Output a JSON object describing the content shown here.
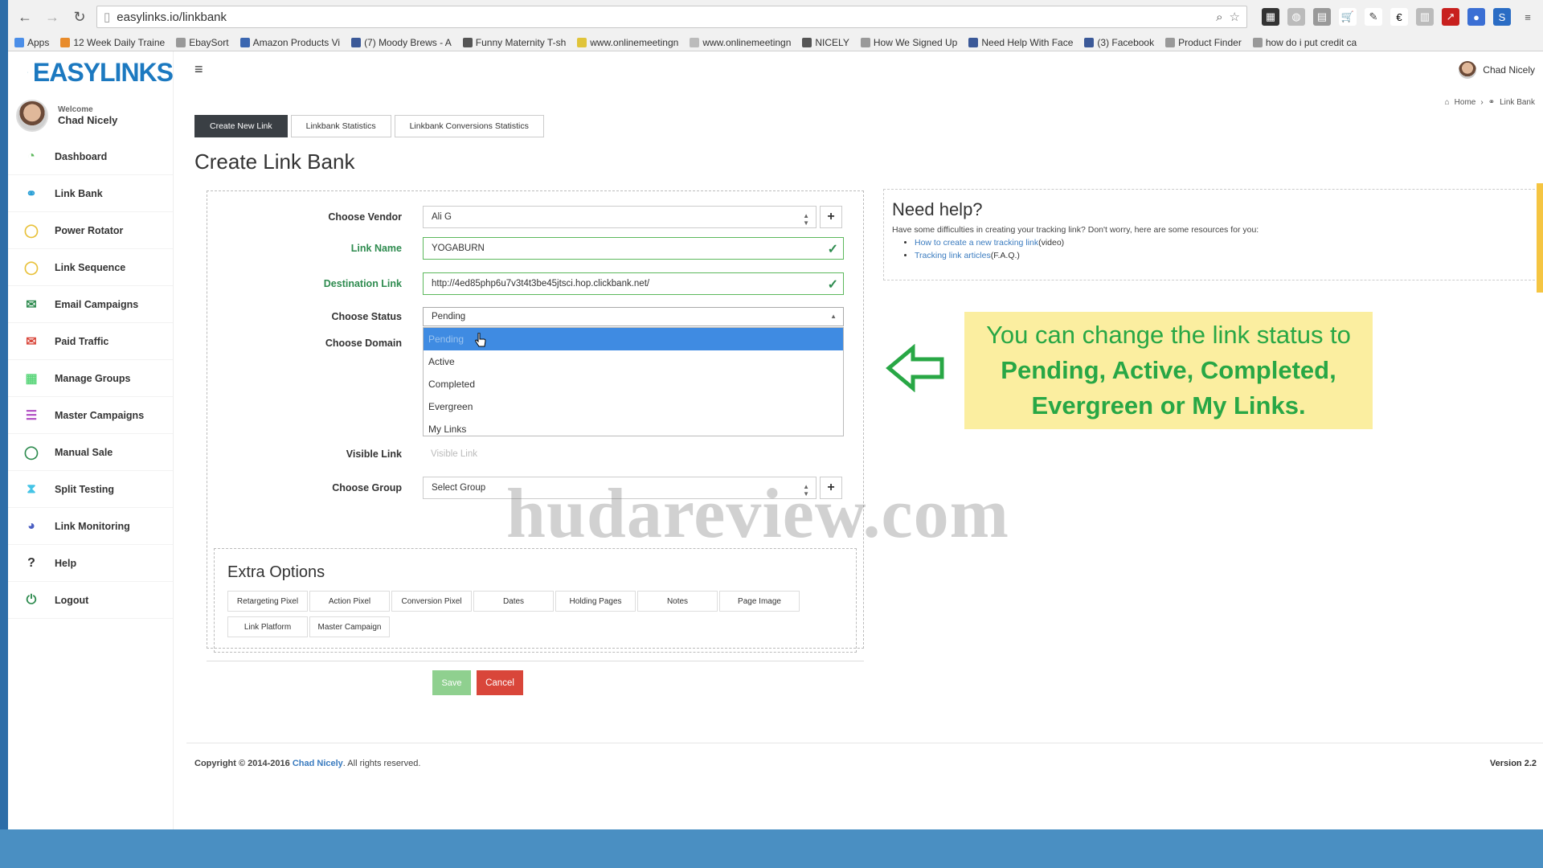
{
  "browser": {
    "url": "easylinks.io/linkbank",
    "bookmarks": [
      {
        "label": "Apps"
      },
      {
        "label": "12 Week Daily Traine"
      },
      {
        "label": "EbaySort"
      },
      {
        "label": "Amazon Products Vi"
      },
      {
        "label": "(7) Moody Brews - A"
      },
      {
        "label": "Funny Maternity T-sh"
      },
      {
        "label": "www.onlinemeetingn"
      },
      {
        "label": "www.onlinemeetingn"
      },
      {
        "label": "NICELY"
      },
      {
        "label": "How We Signed Up"
      },
      {
        "label": "Need Help With Face"
      },
      {
        "label": "(3) Facebook"
      },
      {
        "label": "Product Finder"
      },
      {
        "label": "how do i put credit ca"
      }
    ]
  },
  "brand": {
    "logo_text": "EASYLINKS"
  },
  "user": {
    "welcome": "Welcome",
    "name": "Chad Nicely",
    "top_name": "Chad Nicely"
  },
  "sidebar": {
    "items": [
      {
        "label": "Dashboard",
        "icon": "dashboard-icon",
        "color": "#5cb85c"
      },
      {
        "label": "Link Bank",
        "icon": "link-icon",
        "color": "#2a9fd6"
      },
      {
        "label": "Power Rotator",
        "icon": "rotator-icon",
        "color": "#e8c13a"
      },
      {
        "label": "Link Sequence",
        "icon": "sequence-icon",
        "color": "#e8c13a"
      },
      {
        "label": "Email Campaigns",
        "icon": "email-icon",
        "color": "#2e8b4f"
      },
      {
        "label": "Paid Traffic",
        "icon": "paid-traffic-icon",
        "color": "#d9463a"
      },
      {
        "label": "Manage Groups",
        "icon": "groups-icon",
        "color": "#5cd67c"
      },
      {
        "label": "Master Campaigns",
        "icon": "list-icon",
        "color": "#b04bc2"
      },
      {
        "label": "Manual Sale",
        "icon": "sale-icon",
        "color": "#2e8b4f"
      },
      {
        "label": "Split Testing",
        "icon": "split-icon",
        "color": "#45c4e6"
      },
      {
        "label": "Link Monitoring",
        "icon": "monitor-icon",
        "color": "#4a5ec2"
      },
      {
        "label": "Help",
        "icon": "help-icon",
        "color": "#333333"
      },
      {
        "label": "Logout",
        "icon": "power-icon",
        "color": "#2e8b4f"
      }
    ]
  },
  "breadcrumb": {
    "home": "Home",
    "current": "Link Bank"
  },
  "tabs": [
    "Create New Link",
    "Linkbank Statistics",
    "Linkbank Conversions Statistics"
  ],
  "page_title": "Create Link Bank",
  "form": {
    "vendor_label": "Choose Vendor",
    "vendor_value": "Ali G",
    "link_name_label": "Link Name",
    "link_name_value": "YOGABURN",
    "destination_label": "Destination Link",
    "destination_value": "http://4ed85php6u7v3t4t3be45jtsci.hop.clickbank.net/",
    "status_label": "Choose Status",
    "status_value": "Pending",
    "status_options": [
      "Pending",
      "Active",
      "Completed",
      "Evergreen",
      "My Links"
    ],
    "domain_label": "Choose Domain",
    "visible_label": "Visible Link",
    "visible_placeholder": "Visible Link",
    "group_label": "Choose Group",
    "group_value": "Select Group"
  },
  "extra": {
    "title": "Extra Options",
    "row1": [
      "Retargeting Pixel",
      "Action Pixel",
      "Conversion Pixel",
      "Dates",
      "Holding Pages",
      "Notes",
      "Page Image"
    ],
    "row2": [
      "Link Platform",
      "Master Campaign"
    ]
  },
  "buttons": {
    "save": "Save",
    "cancel": "Cancel"
  },
  "help": {
    "title": "Need help?",
    "text": "Have some difficulties in creating your tracking link? Don't worry, here are some resources for you:",
    "link1": "How to create a new tracking link",
    "link1_suffix": "(video)",
    "link2": "Tracking link articles",
    "link2_suffix": "(F.A.Q.)"
  },
  "callout": {
    "line1": "You can change the link status to",
    "line2": "Pending, Active, Completed,",
    "line3": "Evergreen or My Links."
  },
  "watermark": "hudareview.com",
  "footer": {
    "copyright": "Copyright © 2014-2016",
    "name": "Chad Nicely",
    "rights": ". All rights reserved.",
    "version": "Version 2.2"
  },
  "colors": {
    "accent": "#3f8be2",
    "callout_bg": "#fbeea0",
    "callout_text": "#28a745",
    "cancel": "#d9463a",
    "save": "#8fd08f"
  }
}
